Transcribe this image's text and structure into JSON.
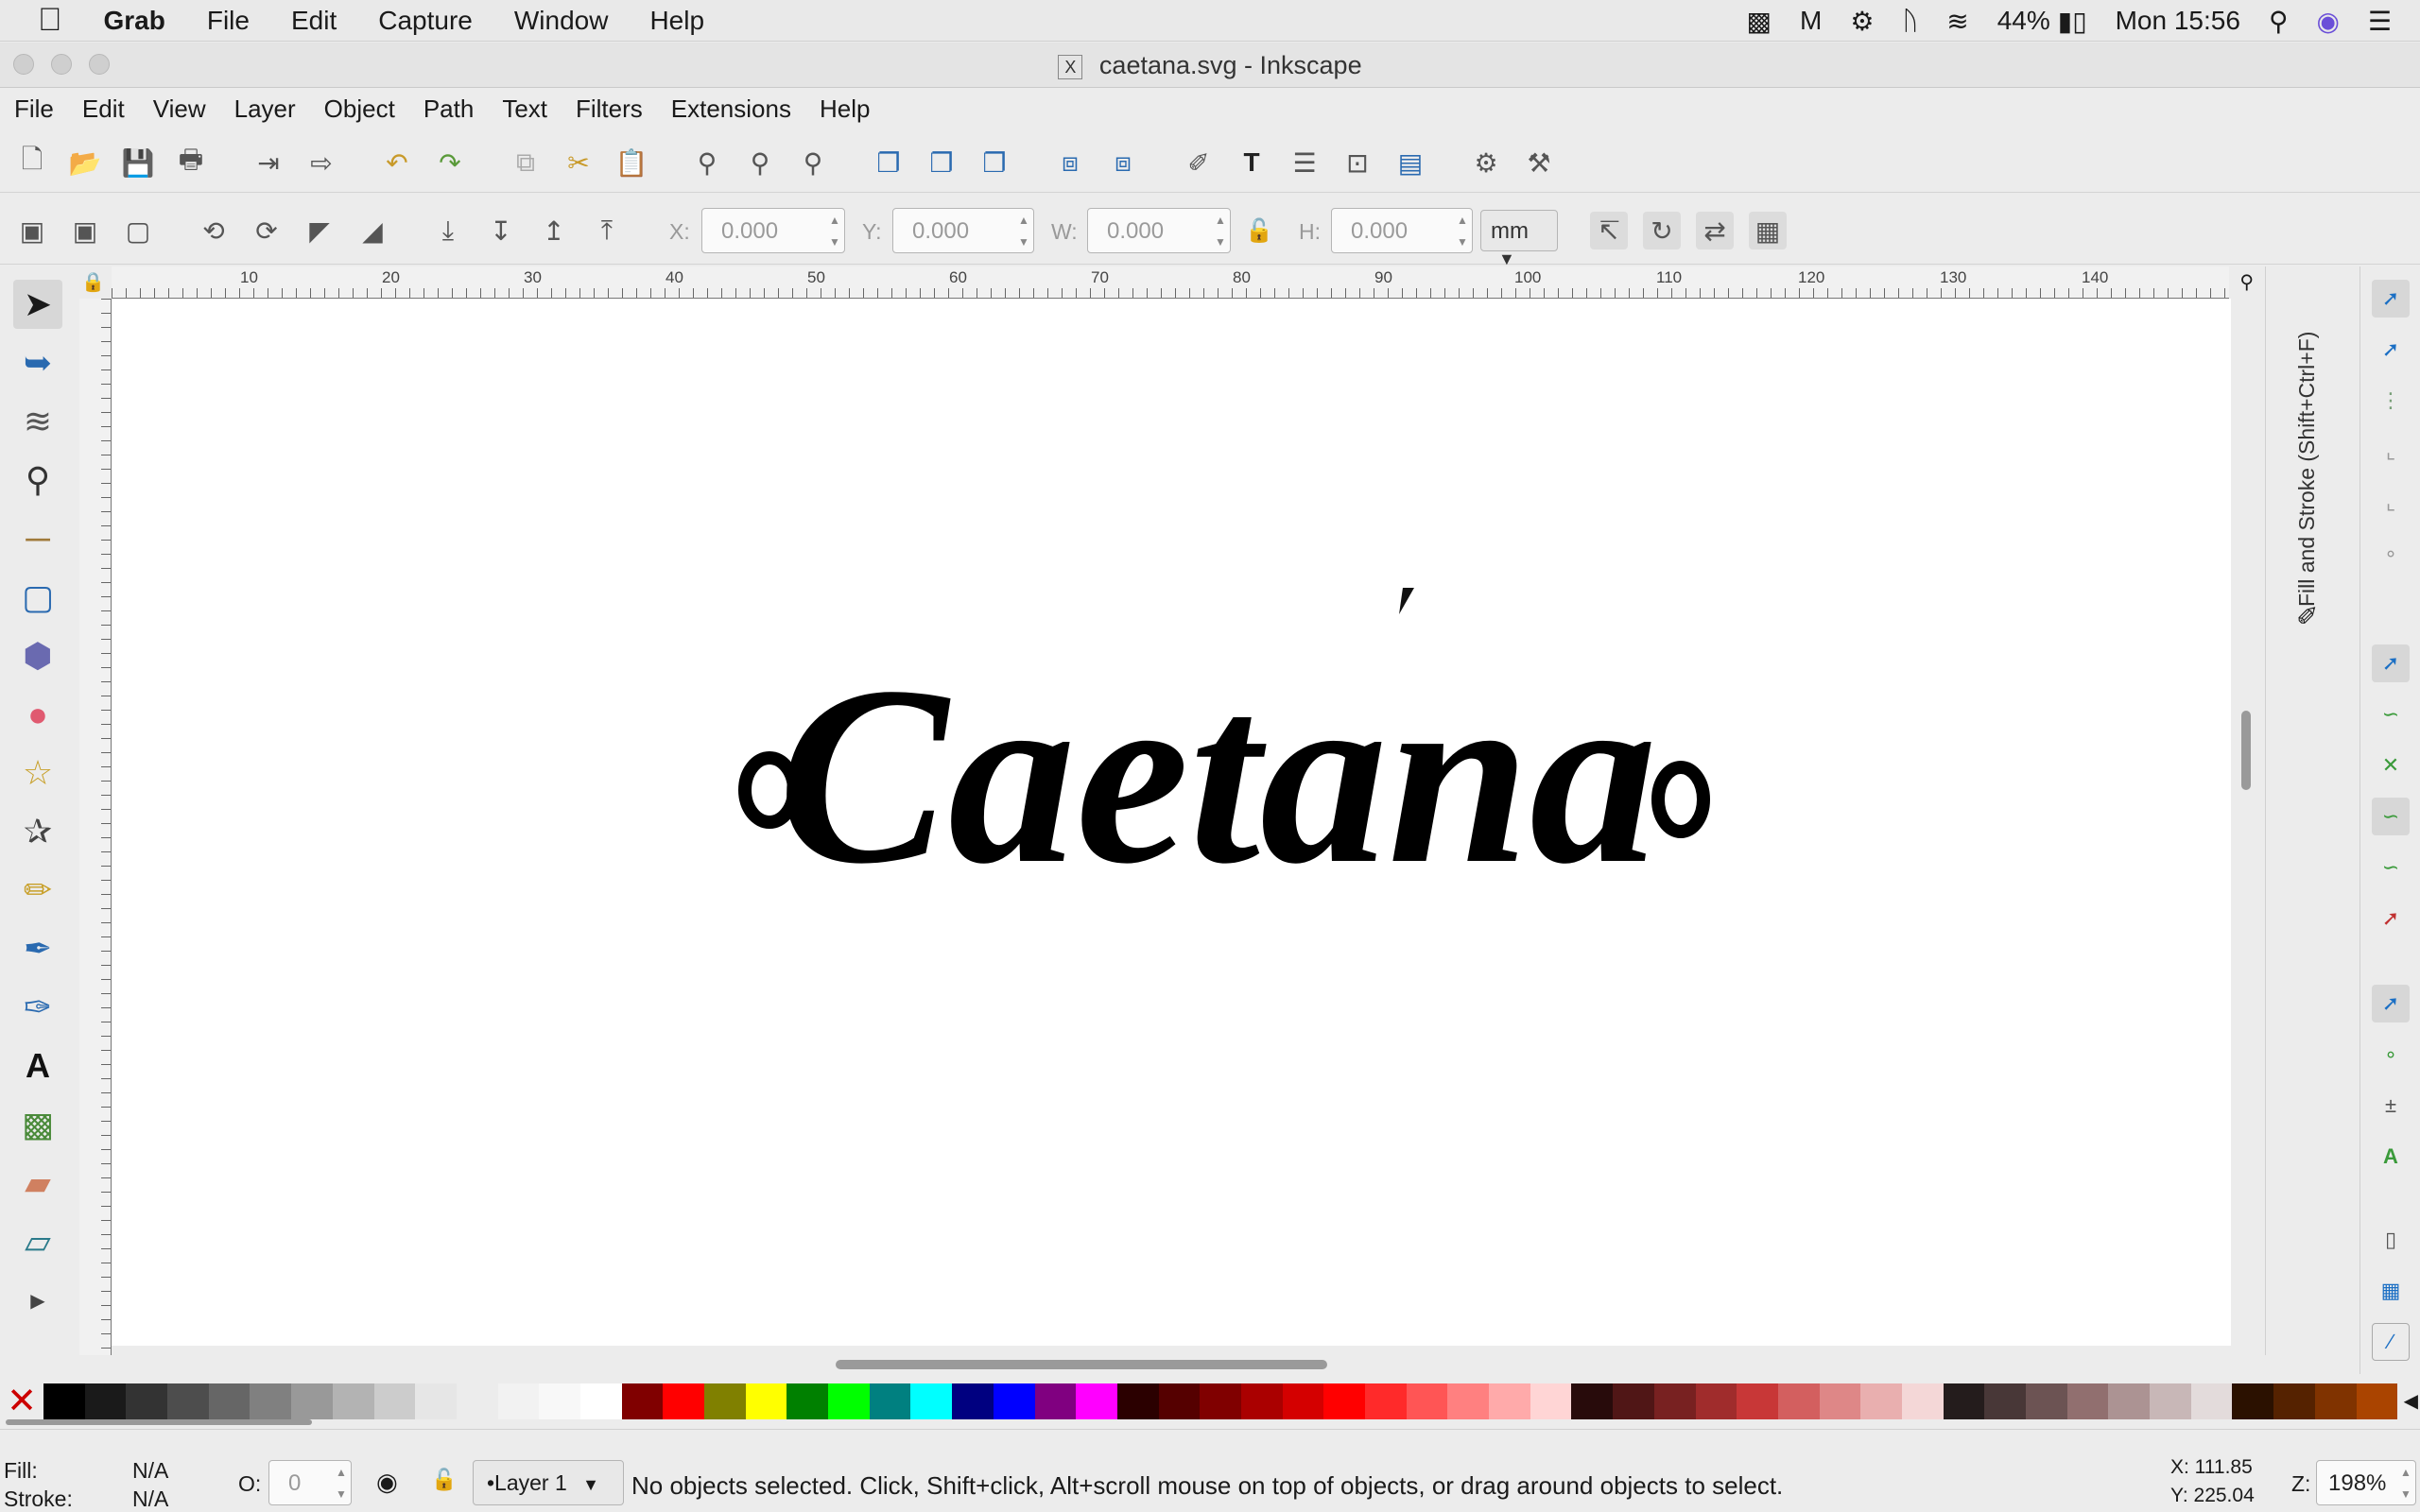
{
  "mac_menu": {
    "app": "Grab",
    "items": [
      "File",
      "Edit",
      "Capture",
      "Window",
      "Help"
    ],
    "battery": "44%",
    "clock": "Mon 15:56"
  },
  "window": {
    "title": "caetana.svg - Inkscape"
  },
  "app_menu": [
    "File",
    "Edit",
    "View",
    "Layer",
    "Object",
    "Path",
    "Text",
    "Filters",
    "Extensions",
    "Help"
  ],
  "ctrl": {
    "x_label": "X:",
    "x_value": "0.000",
    "y_label": "Y:",
    "y_value": "0.000",
    "w_label": "W:",
    "w_value": "0.000",
    "h_label": "H:",
    "h_value": "0.000",
    "unit": "mm"
  },
  "ruler_ticks": [
    "10",
    "20",
    "30",
    "40",
    "50",
    "60",
    "70",
    "80",
    "90",
    "100",
    "110",
    "120",
    "130",
    "140"
  ],
  "canvas_text": "Caetana",
  "dock_label": "Fill and Stroke (Shift+Ctrl+F)",
  "palette_colors": [
    "#000000",
    "#1a1a1a",
    "#333333",
    "#4d4d4d",
    "#666666",
    "#808080",
    "#999999",
    "#b3b3b3",
    "#cccccc",
    "#e6e6e6",
    "#ececec",
    "#f2f2f2",
    "#f8f8f8",
    "#ffffff",
    "#800000",
    "#ff0000",
    "#808000",
    "#ffff00",
    "#008000",
    "#00ff00",
    "#008080",
    "#00ffff",
    "#000080",
    "#0000ff",
    "#800080",
    "#ff00ff",
    "#2b0000",
    "#550000",
    "#800000",
    "#aa0000",
    "#d40000",
    "#ff0000",
    "#ff2a2a",
    "#ff5555",
    "#ff8080",
    "#ffaaaa",
    "#ffd5d5",
    "#280b0b",
    "#501616",
    "#782121",
    "#a02c2c",
    "#c83737",
    "#d35f5f",
    "#de8787",
    "#e9afaf",
    "#f4d7d7",
    "#241c1c",
    "#483737",
    "#6c5353",
    "#916f6f",
    "#ac9393",
    "#c8b7b7",
    "#e3dbdb",
    "#2b1100",
    "#552200",
    "#803300",
    "#aa4400"
  ],
  "status": {
    "fill_label": "Fill:",
    "fill_value": "N/A",
    "stroke_label": "Stroke:",
    "stroke_value": "N/A",
    "opacity_label": "O:",
    "opacity_value": "0",
    "layer": "•Layer 1",
    "message": "No objects selected. Click, Shift+click, Alt+scroll mouse on top of objects, or drag around objects to select.",
    "x_coord": "X: 111.85",
    "y_coord": "Y: 225.04",
    "zoom_label": "Z:",
    "zoom_value": "198%"
  }
}
